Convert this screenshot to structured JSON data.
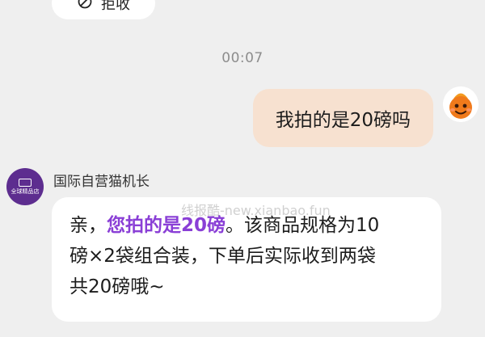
{
  "top_action": {
    "label": "拒收",
    "icon": "reject-icon"
  },
  "timestamp": "00:07",
  "outgoing_message": {
    "text": "我拍的是20磅吗"
  },
  "self_avatar": {
    "icon": "cartoon-avatar-icon",
    "color": "#f07a1b"
  },
  "shop": {
    "name": "国际自营猫机长",
    "avatar_text": "全球精品店",
    "avatar_color": "#5d2d8f"
  },
  "incoming_message": {
    "line1_before": "亲，",
    "highlight": "您拍的是20磅",
    "highlight_color": "#8a3fd6",
    "line1_after": "。该商品规格为10",
    "line2": "磅×2袋组合装，下单后实际收到两袋",
    "line3": "共20磅哦~"
  },
  "watermark": "线报酷-new.xianbao.fun",
  "colors": {
    "background": "#efefef",
    "outgoing_bubble": "#f7e1d0",
    "incoming_bubble": "#ffffff"
  }
}
